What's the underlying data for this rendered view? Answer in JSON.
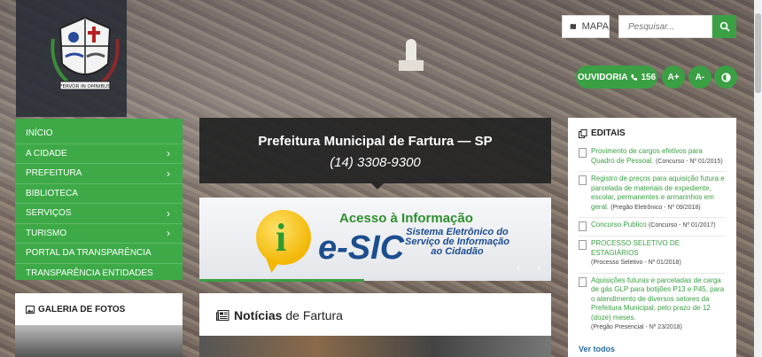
{
  "header": {
    "map_label": "MAPA",
    "search_placeholder": "Pesquisar...",
    "ouvidoria_label": "OUVIDORIA",
    "ouvidoria_phone": "156",
    "font_increase": "A+",
    "font_decrease": "A-",
    "crest_motto": "FERVOR IN OMNIBUS"
  },
  "sidebar": {
    "items": [
      {
        "label": "INÍCIO",
        "chevron": false
      },
      {
        "label": "A CIDADE",
        "chevron": true
      },
      {
        "label": "PREFEITURA",
        "chevron": true
      },
      {
        "label": "BIBLIOTECA",
        "chevron": false
      },
      {
        "label": "SERVIÇOS",
        "chevron": true
      },
      {
        "label": "TURISMO",
        "chevron": true
      },
      {
        "label": "PORTAL DA TRANSPARÊNCIA",
        "chevron": false
      },
      {
        "label": "TRANSPARÊNCIA ENTIDADES",
        "chevron": false
      }
    ]
  },
  "gallery": {
    "title": "GALERIA DE FOTOS"
  },
  "main": {
    "title": "Prefeitura Municipal de Fartura — SP",
    "phone": "(14) 3308-9300",
    "banner": {
      "acesso": "Acesso à Informação",
      "esic": "e-SIC",
      "sistema": "Sistema Eletrônico do Serviço de Informação ao Cidadão"
    },
    "news_bold": "Notícias",
    "news_rest": " de Fartura"
  },
  "editais": {
    "title": "EDITAIS",
    "items": [
      {
        "link": "Provimento de cargos efetivos para Quadro de Pessoal.",
        "meta": "(Concurso - Nº 01/2015)"
      },
      {
        "link": "Registro de preços para aquisição futura e parcelada de materiais de expediente, escolar, permanentes e armarinhos em geral.",
        "meta": "(Pregão Eletrônico - Nº 09/2018)"
      },
      {
        "link": "Concurso Publico",
        "meta": "(Concurso - Nº 01/2017)"
      },
      {
        "link": "PROCESSO SELETIVO DE ESTAGIÁRIOS",
        "meta": "(Processo Seletivo - Nº 01/2018)"
      },
      {
        "link": "Aquisições futuras e parceladas de carga de gás GLP para botijões P13 e P45, para o atendimento de diversos setores da Prefeitura Municipal, pelo prazo de 12 (doze) meses.",
        "meta": "(Pregão Presencial - Nº 23/2018)"
      }
    ],
    "ver_todos": "Ver todos"
  },
  "colors": {
    "accent_green": "#3aa043",
    "dark_box": "#232323",
    "link_blue": "#2b6ca3"
  }
}
